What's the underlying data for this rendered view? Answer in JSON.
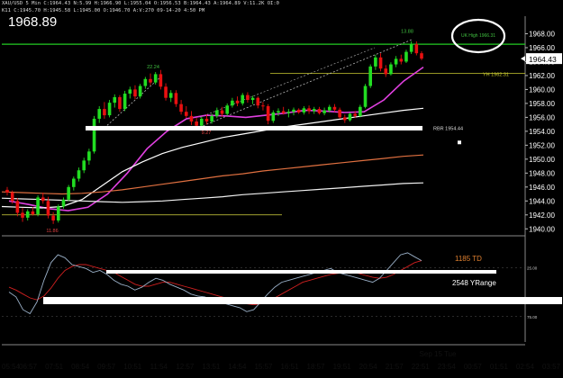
{
  "header": {
    "line1": "XAU/USD 5 Min  C:1964.43  N:5.99  H:1966.90  L:1955.04  O:1956.53  B:1964.43  A:1964.89  V:11.2K  OI:0",
    "line2": "K11  C:1945.70  H:1945.58  L:1945.00  O:1946.70  A:V:270  09-14-20  4:50 PM"
  },
  "chart_data": {
    "type": "candlestick",
    "title": "1968.89",
    "current_price": 1964.43,
    "current_price_label": "1964.43",
    "ylim": [
      1939,
      1970
    ],
    "yticks": [
      1940,
      1942,
      1944,
      1946,
      1948,
      1950,
      1952,
      1954,
      1956,
      1958,
      1960,
      1962,
      1964,
      1966,
      1968
    ],
    "ytick_labels": [
      "1940.00",
      "1942.00",
      "1944.00",
      "1946.00",
      "1948.00",
      "1950.00",
      "1952.00",
      "1954.00",
      "1956.00",
      "1958.00",
      "1960.00",
      "1962.00",
      "1964.00",
      "1966.00",
      "1968.00"
    ],
    "xtick_labels": [
      "05:54",
      "06:57",
      "07:51",
      "08:54",
      "09:57",
      "10:51",
      "11:54",
      "12:57",
      "13:51",
      "14:54",
      "15:57",
      "16:51",
      "18:57",
      "19:51",
      "20:54",
      "21:57",
      "22:51",
      "23:54",
      "00:57",
      "01:51",
      "02:54",
      "03:57"
    ],
    "date_label": "Sep 15 Tue",
    "candles": [
      [
        1945.6,
        1946.0,
        1944.8,
        1945.2
      ],
      [
        1945.2,
        1945.5,
        1943.6,
        1944.0
      ],
      [
        1944.0,
        1944.4,
        1941.8,
        1942.3
      ],
      [
        1942.3,
        1943.0,
        1941.0,
        1941.6
      ],
      [
        1941.6,
        1942.8,
        1941.2,
        1942.5
      ],
      [
        1942.5,
        1943.1,
        1941.9,
        1942.1
      ],
      [
        1942.1,
        1944.8,
        1941.8,
        1944.5
      ],
      [
        1944.5,
        1945.2,
        1943.6,
        1944.0
      ],
      [
        1944.0,
        1944.6,
        1941.5,
        1941.9
      ],
      [
        1941.9,
        1942.4,
        1940.7,
        1941.2
      ],
      [
        1941.2,
        1943.5,
        1940.9,
        1943.2
      ],
      [
        1943.2,
        1944.5,
        1942.9,
        1944.2
      ],
      [
        1944.2,
        1946.3,
        1944.0,
        1946.0
      ],
      [
        1946.0,
        1947.5,
        1945.5,
        1947.2
      ],
      [
        1947.2,
        1948.8,
        1946.8,
        1948.4
      ],
      [
        1948.4,
        1950.2,
        1948.0,
        1949.8
      ],
      [
        1949.8,
        1951.5,
        1949.2,
        1951.1
      ],
      [
        1951.1,
        1956.2,
        1950.8,
        1955.8
      ],
      [
        1955.8,
        1957.6,
        1955.2,
        1957.2
      ],
      [
        1957.2,
        1958.2,
        1955.8,
        1956.3
      ],
      [
        1956.3,
        1958.5,
        1956.0,
        1958.1
      ],
      [
        1958.1,
        1959.3,
        1957.4,
        1958.9
      ],
      [
        1958.9,
        1959.2,
        1956.8,
        1957.2
      ],
      [
        1957.2,
        1959.8,
        1956.9,
        1959.4
      ],
      [
        1959.4,
        1960.4,
        1958.7,
        1960.0
      ],
      [
        1960.0,
        1960.6,
        1958.6,
        1959.0
      ],
      [
        1959.0,
        1960.8,
        1958.7,
        1960.5
      ],
      [
        1960.5,
        1961.8,
        1960.1,
        1961.5
      ],
      [
        1961.5,
        1962.3,
        1960.6,
        1961.0
      ],
      [
        1961.0,
        1962.5,
        1960.7,
        1962.2
      ],
      [
        1962.2,
        1962.8,
        1960.0,
        1960.4
      ],
      [
        1960.4,
        1960.9,
        1958.4,
        1958.8
      ],
      [
        1958.8,
        1959.9,
        1958.2,
        1959.5
      ],
      [
        1959.5,
        1959.9,
        1957.5,
        1957.9
      ],
      [
        1957.9,
        1958.5,
        1956.4,
        1956.8
      ],
      [
        1956.8,
        1957.6,
        1955.9,
        1956.2
      ],
      [
        1956.2,
        1956.9,
        1954.9,
        1955.4
      ],
      [
        1955.4,
        1955.9,
        1954.3,
        1954.8
      ],
      [
        1954.8,
        1956.1,
        1954.5,
        1955.8
      ],
      [
        1955.8,
        1956.4,
        1955.0,
        1955.4
      ],
      [
        1955.4,
        1956.5,
        1955.1,
        1956.2
      ],
      [
        1956.2,
        1957.4,
        1955.9,
        1957.0
      ],
      [
        1957.0,
        1957.5,
        1956.1,
        1956.5
      ],
      [
        1956.5,
        1958.0,
        1956.2,
        1957.7
      ],
      [
        1957.7,
        1958.8,
        1957.4,
        1958.4
      ],
      [
        1958.4,
        1959.0,
        1957.6,
        1958.0
      ],
      [
        1958.0,
        1959.5,
        1957.7,
        1959.2
      ],
      [
        1959.2,
        1959.6,
        1958.1,
        1958.5
      ],
      [
        1958.5,
        1959.1,
        1957.9,
        1958.8
      ],
      [
        1958.8,
        1959.0,
        1957.3,
        1957.7
      ],
      [
        1957.7,
        1958.2,
        1957.0,
        1957.6
      ],
      [
        1957.6,
        1957.9,
        1955.0,
        1955.5
      ],
      [
        1955.5,
        1957.0,
        1955.2,
        1956.7
      ],
      [
        1956.7,
        1957.3,
        1956.2,
        1956.9
      ],
      [
        1956.9,
        1957.5,
        1956.4,
        1956.6
      ],
      [
        1956.6,
        1957.2,
        1956.0,
        1956.8
      ],
      [
        1956.8,
        1957.4,
        1956.3,
        1957.1
      ],
      [
        1957.1,
        1957.3,
        1956.5,
        1956.7
      ],
      [
        1956.7,
        1957.6,
        1956.4,
        1957.3
      ],
      [
        1957.3,
        1957.7,
        1956.5,
        1956.9
      ],
      [
        1956.9,
        1957.5,
        1956.5,
        1957.2
      ],
      [
        1957.2,
        1957.5,
        1956.4,
        1956.6
      ],
      [
        1956.6,
        1957.4,
        1956.3,
        1957.0
      ],
      [
        1957.0,
        1957.8,
        1956.7,
        1957.5
      ],
      [
        1957.5,
        1957.9,
        1956.8,
        1957.1
      ],
      [
        1957.1,
        1957.4,
        1955.8,
        1956.0
      ],
      [
        1956.0,
        1956.4,
        1955.2,
        1955.6
      ],
      [
        1955.6,
        1956.7,
        1955.4,
        1956.5
      ],
      [
        1956.5,
        1956.9,
        1955.9,
        1956.2
      ],
      [
        1956.2,
        1957.8,
        1956.0,
        1957.5
      ],
      [
        1957.5,
        1960.8,
        1957.3,
        1960.5
      ],
      [
        1960.5,
        1963.6,
        1960.2,
        1963.3
      ],
      [
        1963.3,
        1965.0,
        1962.8,
        1964.6
      ],
      [
        1964.6,
        1965.2,
        1962.6,
        1963.0
      ],
      [
        1963.0,
        1963.5,
        1961.8,
        1962.2
      ],
      [
        1962.2,
        1963.9,
        1962.0,
        1963.6
      ],
      [
        1963.6,
        1964.8,
        1963.2,
        1964.4
      ],
      [
        1964.4,
        1965.0,
        1963.6,
        1964.0
      ],
      [
        1964.0,
        1965.7,
        1963.8,
        1965.4
      ],
      [
        1965.4,
        1966.9,
        1965.1,
        1966.5
      ],
      [
        1966.5,
        1966.9,
        1964.9,
        1965.2
      ],
      [
        1965.2,
        1965.5,
        1964.2,
        1964.43
      ]
    ],
    "moving_averages": [
      {
        "color": "#e040e0",
        "values": [
          1944.0,
          1943.5,
          1942.9,
          1942.6,
          1943.1,
          1945.0,
          1948.0,
          1951.5,
          1954.0,
          1955.8,
          1956.3,
          1956.2,
          1956.0,
          1956.3,
          1956.6,
          1957.0,
          1956.9,
          1956.7,
          1956.8,
          1958.5,
          1961.2,
          1963.2
        ]
      },
      {
        "color": "#ffffff",
        "values": [
          1943.2,
          1943.1,
          1943.0,
          1943.2,
          1944.2,
          1946.2,
          1948.2,
          1949.6,
          1950.8,
          1951.7,
          1952.4,
          1953.1,
          1953.6,
          1954.1,
          1954.6,
          1955.0,
          1955.4,
          1955.8,
          1956.2,
          1956.6,
          1957.0,
          1957.3
        ]
      },
      {
        "color": "#e07040",
        "values": [
          1945.3,
          1945.2,
          1945.1,
          1945.0,
          1945.1,
          1945.3,
          1945.6,
          1946.0,
          1946.4,
          1946.8,
          1947.2,
          1947.6,
          1947.9,
          1948.3,
          1948.6,
          1948.9,
          1949.2,
          1949.5,
          1949.8,
          1950.1,
          1950.4,
          1950.6
        ]
      },
      {
        "color": "#f0f0f0",
        "values": [
          1944.4,
          1944.3,
          1944.2,
          1944.1,
          1944.0,
          1943.9,
          1943.8,
          1943.9,
          1944.0,
          1944.2,
          1944.4,
          1944.6,
          1944.9,
          1945.1,
          1945.3,
          1945.5,
          1945.7,
          1945.9,
          1946.1,
          1946.3,
          1946.5,
          1946.6
        ]
      }
    ],
    "reference_lines": [
      {
        "name": "UK High",
        "value": 1966.5,
        "color": "#22cc22",
        "label": "UK High 1966.31"
      },
      {
        "name": "YH",
        "value": 1962.3,
        "color": "#c8c830",
        "label": "YH 1962.31"
      },
      {
        "name": "EW",
        "value": 1942.0,
        "color": "#d8d840",
        "label": ""
      }
    ],
    "support_zone": {
      "value": 1954.44,
      "label": "RBR 1954.44"
    },
    "annotations": [
      "22.24",
      "9.27",
      "13.88",
      "11.86"
    ],
    "subpanel": {
      "title": "STO",
      "side_value": "15.",
      "level_labels": [
        "25.00",
        "75.00"
      ],
      "td_label": "1185 TD",
      "range_label": "2548 YRange",
      "stoch_k": [
        50,
        45,
        32,
        28,
        40,
        62,
        80,
        88,
        85,
        78,
        76,
        74,
        70,
        72,
        68,
        62,
        58,
        56,
        52,
        55,
        60,
        64,
        62,
        58,
        55,
        52,
        48,
        46,
        45,
        42,
        40,
        38,
        36,
        34,
        30,
        32,
        40,
        48,
        55,
        60,
        62,
        64,
        66,
        68,
        70,
        72,
        74,
        70,
        68,
        66,
        64,
        62,
        60,
        64,
        72,
        80,
        88,
        90,
        86,
        82
      ],
      "stoch_d": [
        55,
        52,
        48,
        44,
        42,
        46,
        54,
        64,
        72,
        76,
        78,
        78,
        76,
        74,
        72,
        70,
        66,
        62,
        58,
        56,
        56,
        58,
        60,
        60,
        58,
        56,
        54,
        52,
        50,
        48,
        46,
        44,
        42,
        40,
        38,
        37,
        38,
        40,
        44,
        48,
        52,
        56,
        60,
        62,
        64,
        66,
        68,
        69,
        70,
        70,
        69,
        67,
        65,
        64,
        65,
        68,
        72,
        76,
        80,
        82
      ]
    }
  }
}
